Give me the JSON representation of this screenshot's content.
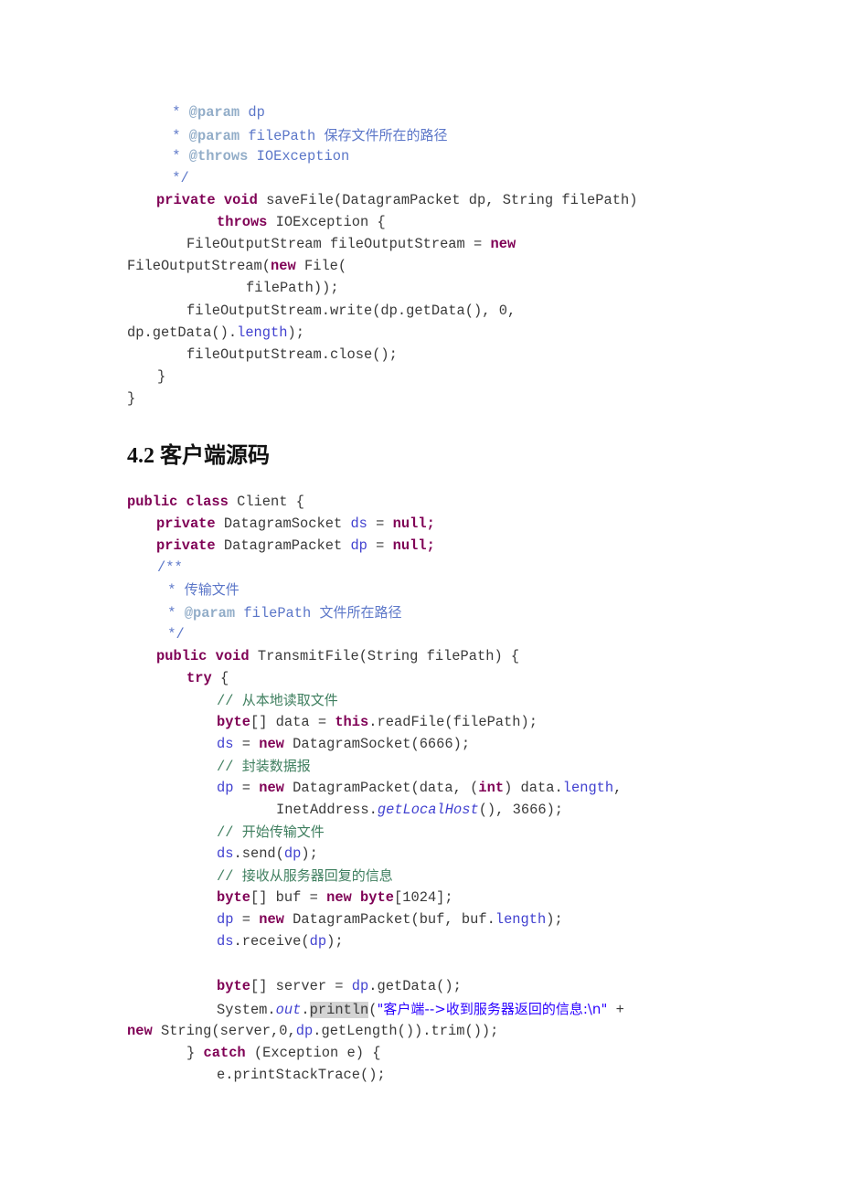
{
  "section_heading": "4.2 客户端源码",
  "server_tail": {
    "l1": {
      "star": " * ",
      "tag": "@param",
      "rest": " dp"
    },
    "l2": {
      "star": " * ",
      "tag": "@param",
      "rest": " filePath ",
      "cn": "保存文件所在的路径"
    },
    "l3": {
      "star": " * ",
      "tag": "@throws",
      "rest": " IOException"
    },
    "l4": " */",
    "l5": {
      "kw1": "private",
      "kw2": "void",
      "rest": " saveFile(DatagramPacket dp, String filePath)"
    },
    "l6": {
      "kw": "throws",
      "rest": " IOException {"
    },
    "l7": {
      "a": "FileOutputStream fileOutputStream = ",
      "kw": "new"
    },
    "l8": {
      "a": "FileOutputStream(",
      "kw": "new",
      "b": " File("
    },
    "l9": "filePath));",
    "l10": "fileOutputStream.write(dp.getData(), 0,",
    "l11": {
      "a": "dp.getData().",
      "field": "length",
      "b": ");"
    },
    "l12": "fileOutputStream.close();",
    "l13": "}",
    "l14": "}"
  },
  "client": {
    "c1": {
      "kw1": "public",
      "kw2": "class",
      "rest": " Client {"
    },
    "c2": {
      "kw": "private",
      "type": " DatagramSocket ",
      "field": "ds",
      "eq": " = ",
      "null": "null",
      "semi": ";"
    },
    "c3": {
      "kw": "private",
      "type": " DatagramPacket ",
      "field": "dp",
      "eq": " = ",
      "null": "null",
      "semi": ";"
    },
    "c4": "/**",
    "c5": {
      "star": " * ",
      "cn": "传输文件"
    },
    "c6": {
      "star": " * ",
      "tag": "@param",
      "rest": " filePath ",
      "cn": "文件所在路径"
    },
    "c7": " */",
    "c8": {
      "kw1": "public",
      "kw2": "void",
      "rest": " TransmitFile(String filePath) {"
    },
    "c9": {
      "kw": "try",
      "rest": " {"
    },
    "c10": {
      "slashes": "// ",
      "cn": "从本地读取文件"
    },
    "c11": {
      "kw": "byte",
      "a": "[] data = ",
      "kw2": "this",
      "b": ".readFile(filePath);"
    },
    "c12": {
      "field": "ds",
      "eq": " = ",
      "kw": "new",
      "rest": " DatagramSocket(6666);"
    },
    "c13": {
      "slashes": "// ",
      "cn": "封装数据报"
    },
    "c14": {
      "field": "dp",
      "eq": " = ",
      "kw": "new",
      "a": " DatagramPacket(data, (",
      "kw2": "int",
      "b": ") data.",
      "field2": "length",
      "c": ","
    },
    "c15": {
      "a": "InetAddress.",
      "it": "getLocalHost",
      "b": "(), 3666);"
    },
    "c16": {
      "slashes": "// ",
      "cn": "开始传输文件"
    },
    "c17": {
      "field": "ds",
      "a": ".send(",
      "field2": "dp",
      "b": ");"
    },
    "c18": {
      "slashes": "// ",
      "cn": "接收从服务器回复的信息"
    },
    "c19": {
      "kw": "byte",
      "a": "[] buf = ",
      "kw2": "new",
      "sp": " ",
      "kw3": "byte",
      "b": "[1024];"
    },
    "c20": {
      "field": "dp",
      "eq": " = ",
      "kw": "new",
      "a": " DatagramPacket(buf, buf.",
      "field2": "length",
      "b": ");"
    },
    "c21": {
      "field": "ds",
      "a": ".receive(",
      "field2": "dp",
      "b": ");"
    },
    "c22": {
      "kw": "byte",
      "a": "[] server = ",
      "field": "dp",
      "b": ".getData();"
    },
    "c23": {
      "a": "System.",
      "it": "out",
      "dot": ".",
      "hl": "println",
      "b": "(",
      "str": "\"客户端-->收到服务器返回的信息:\\n\"",
      "c": " +"
    },
    "c24": {
      "kw": "new",
      "a": " String(server,0,",
      "field": "dp",
      "b": ".getLength()).trim());"
    },
    "c25": {
      "a": "} ",
      "kw": "catch",
      "b": " (Exception e) {"
    },
    "c26": "e.printStackTrace();"
  }
}
